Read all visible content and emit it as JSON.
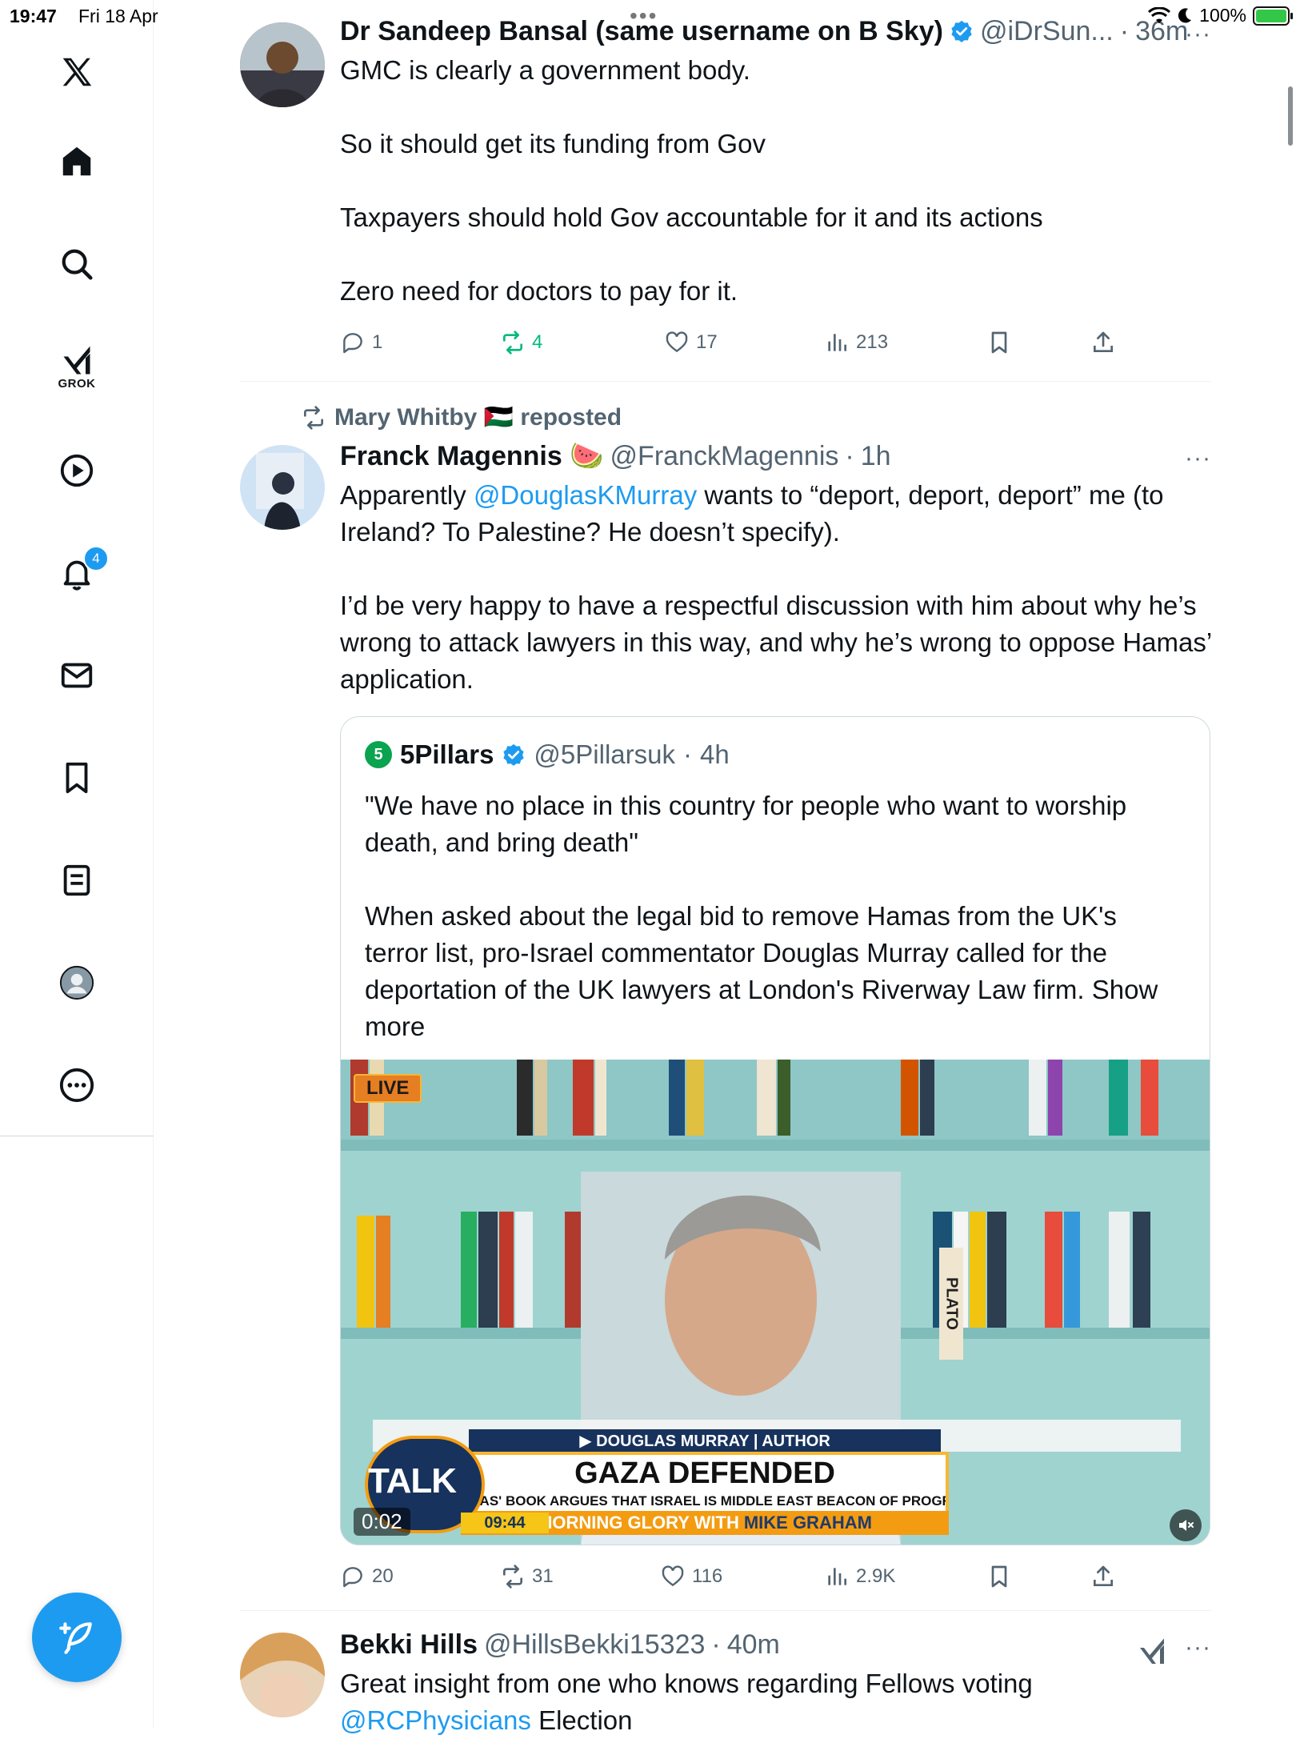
{
  "status_bar": {
    "time": "19:47",
    "date": "Fri 18 Apr",
    "battery": "100%",
    "icons": [
      "wifi-icon",
      "moon-icon",
      "battery-charging-icon"
    ],
    "top_dots": "•••"
  },
  "sidebar": {
    "items": [
      {
        "name": "x-logo",
        "label": ""
      },
      {
        "name": "home-icon",
        "label": ""
      },
      {
        "name": "search-icon",
        "label": ""
      },
      {
        "name": "grok-icon",
        "label": "GROK"
      },
      {
        "name": "video-icon",
        "label": ""
      },
      {
        "name": "notifications-icon",
        "label": "",
        "badge": "4"
      },
      {
        "name": "messages-icon",
        "label": ""
      },
      {
        "name": "bookmarks-icon",
        "label": ""
      },
      {
        "name": "lists-icon",
        "label": ""
      },
      {
        "name": "profile-icon",
        "label": ""
      },
      {
        "name": "more-icon",
        "label": ""
      }
    ],
    "compose": "compose-icon"
  },
  "colors": {
    "accent": "#1d9bf0",
    "repost_green": "#00ba7c",
    "muted": "#536471"
  },
  "tweets": [
    {
      "name": "Dr Sandeep Bansal (same username on B Sky)",
      "verified": true,
      "handle": "@iDrSun...",
      "time": "36m",
      "more": "···",
      "paragraphs": [
        "GMC is clearly a government body.",
        "So it should get its funding from Gov",
        "Taxpayers should hold Gov accountable for it and its actions",
        "Zero need for doctors to pay for it."
      ],
      "stats": {
        "replies": "1",
        "reposts": "4",
        "likes": "17",
        "views": "213"
      }
    },
    {
      "repost_by": "Mary Whitby 🇵🇸 reposted",
      "name": "Franck Magennis 🍉",
      "handle": "@FranckMagennis",
      "time": "1h",
      "more": "···",
      "p1_before": "Apparently ",
      "p1_link": "@DouglasKMurray",
      "p1_after": " wants to “deport, deport, deport” me (to Ireland? To Palestine? He doesn’t specify).",
      "p2": "I’d be very happy to have a respectful discussion with him about why he’s wrong to attack lawyers in this way, and why he’s wrong to oppose Hamas’ application.",
      "quote": {
        "logo": "5",
        "name": "5Pillars",
        "verified": true,
        "handle": "@5Pillarsuk",
        "time": "4h",
        "p1": "\"We have no place in this country for people who want to worship death, and bring death\"",
        "p2": "When asked about the legal bid to remove Hamas from the UK's terror list, pro-Israel commentator Douglas Murray called for the deportation of the UK lawyers at London's Riverway Law firm. Show more",
        "video": {
          "live": "LIVE",
          "channel": "TALK",
          "strap_name": "▶ DOUGLAS MURRAY | AUTHOR",
          "headline": "GAZA DEFENDED",
          "subline": "DOUGLAS' BOOK ARGUES THAT ISRAEL IS MIDDLE EAST BEACON OF PROGRESS",
          "show_a": "MORNING GLORY WITH ",
          "show_b": "MIKE GRAHAM",
          "clock": "09:44",
          "duration": "0:02",
          "book_spine": "PLATO",
          "mute_icon": "speaker-muted-icon"
        }
      },
      "stats": {
        "replies": "20",
        "reposts": "31",
        "likes": "116",
        "views": "2.9K"
      }
    },
    {
      "name": "Bekki Hills",
      "handle": "@HillsBekki15323",
      "time": "40m",
      "more": "···",
      "line1": "Great insight from one who knows regarding Fellows voting",
      "line2_link": "@RCPhysicians",
      "line2_after": " Election"
    }
  ]
}
